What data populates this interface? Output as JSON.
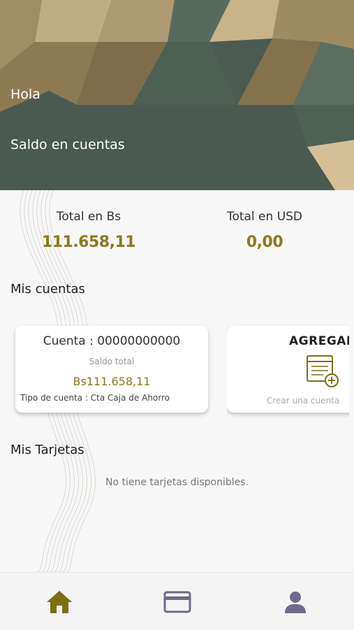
{
  "header": {
    "greeting": "Hola",
    "balance_title": "Saldo en cuentas"
  },
  "totals": {
    "bs_label": "Total en Bs",
    "bs_value": "111.658,11",
    "usd_label": "Total en USD",
    "usd_value": "0,00"
  },
  "accounts_section": {
    "title": "Mis cuentas",
    "account": {
      "number": "Cuenta : 00000000000",
      "balance_label": "Saldo total",
      "balance": "Bs111.658,11",
      "type": "Tipo de cuenta : Cta Caja de Ahorro"
    },
    "add_card": {
      "title": "AGREGAR",
      "subtitle": "Crear una cuenta",
      "icon": "add-document-icon"
    }
  },
  "cards_section": {
    "title": "Mis Tarjetas",
    "empty_message": "No tiene tarjetas disponibles."
  },
  "nav": {
    "items": [
      {
        "icon": "home-icon",
        "active": true
      },
      {
        "icon": "card-icon",
        "active": false
      },
      {
        "icon": "person-icon",
        "active": false
      }
    ]
  },
  "colors": {
    "gold": "#8a7a1e",
    "header_green": "#4a5a50",
    "nav_active": "#7e6e10",
    "nav_inactive": "#6d6a8c"
  }
}
